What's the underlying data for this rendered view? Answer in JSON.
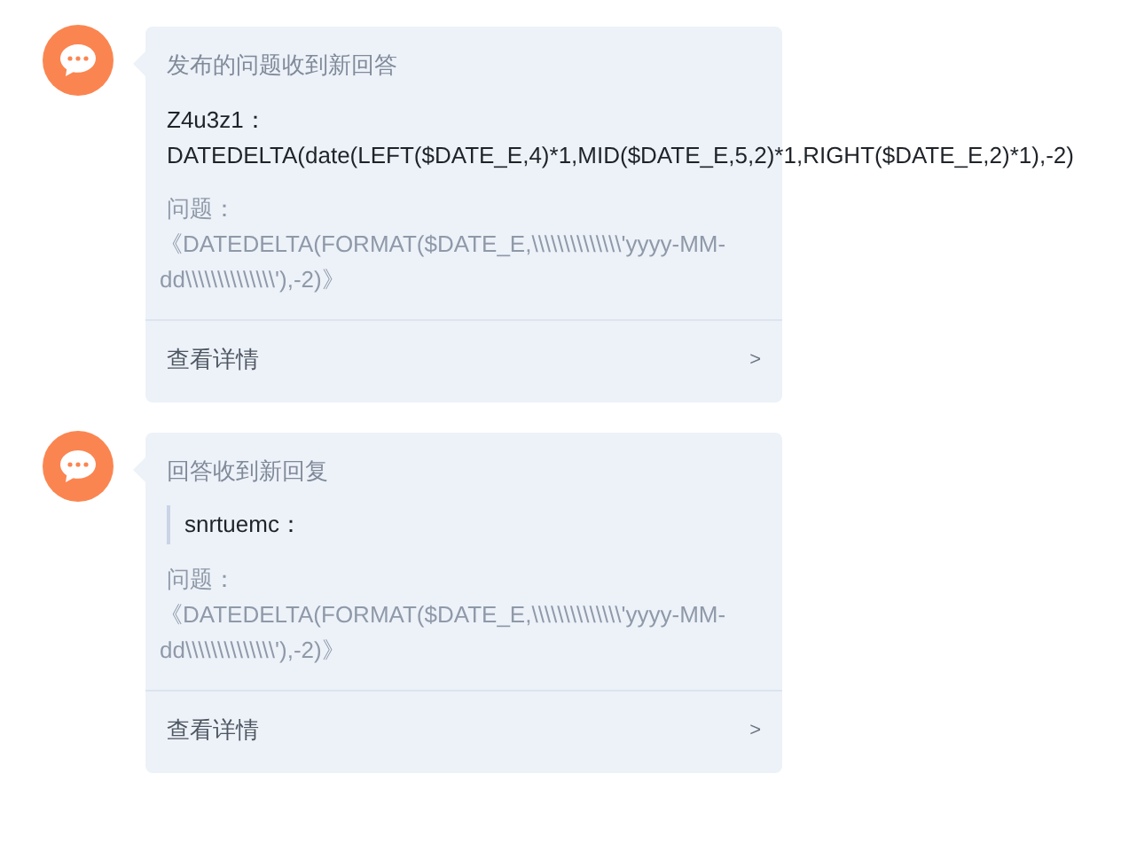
{
  "notifications": [
    {
      "kind": "answer",
      "title": "发布的问题收到新回答",
      "author": "Z4u3z1：",
      "content": "DATEDELTA(date(LEFT($DATE_E,4)*1,MID($DATE_E,5,2)*1,RIGHT($DATE_E,2)*1),-2)",
      "question_label": "问题：",
      "question": "《DATEDELTA(FORMAT($DATE_E,\\\\\\\\\\\\\\\\\\\\\\\\\\\\'yyyy-MM-dd\\\\\\\\\\\\\\\\\\\\\\\\\\\\'),-2)》",
      "link": "查看详情",
      "chevron": ">"
    },
    {
      "kind": "reply",
      "title": "回答收到新回复",
      "author": "snrtuemc：",
      "question_label": "问题：",
      "question": "《DATEDELTA(FORMAT($DATE_E,\\\\\\\\\\\\\\\\\\\\\\\\\\\\'yyyy-MM-dd\\\\\\\\\\\\\\\\\\\\\\\\\\\\'),-2)》",
      "link": "查看详情",
      "chevron": ">"
    }
  ]
}
